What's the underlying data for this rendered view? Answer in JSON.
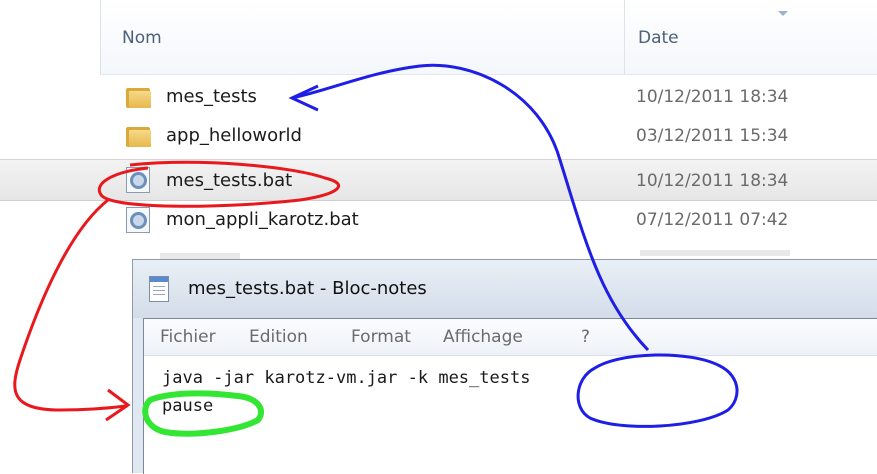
{
  "explorer": {
    "columns": {
      "name": "Nom",
      "date": "Date"
    },
    "files": [
      {
        "name": "mes_tests",
        "date": "10/12/2011 18:34",
        "icon": "folder-icon",
        "selected": false
      },
      {
        "name": "app_helloworld",
        "date": "03/12/2011 15:34",
        "icon": "folder-icon",
        "selected": false
      },
      {
        "name": "mes_tests.bat",
        "date": "10/12/2011 18:34",
        "icon": "batch-file-icon",
        "selected": true
      },
      {
        "name": "mon_appli_karotz.bat",
        "date": "07/12/2011 07:42",
        "icon": "batch-file-icon",
        "selected": false
      }
    ]
  },
  "notepad": {
    "title": "mes_tests.bat - Bloc-notes",
    "menu": [
      "Fichier",
      "Edition",
      "Format",
      "Affichage",
      "?"
    ],
    "lines": [
      "java -jar karotz-vm.jar -k mes_tests",
      "pause"
    ]
  },
  "annotations": {
    "colors": {
      "red": "#e8181c",
      "blue": "#1e1ee6",
      "green": "#33e633"
    }
  }
}
